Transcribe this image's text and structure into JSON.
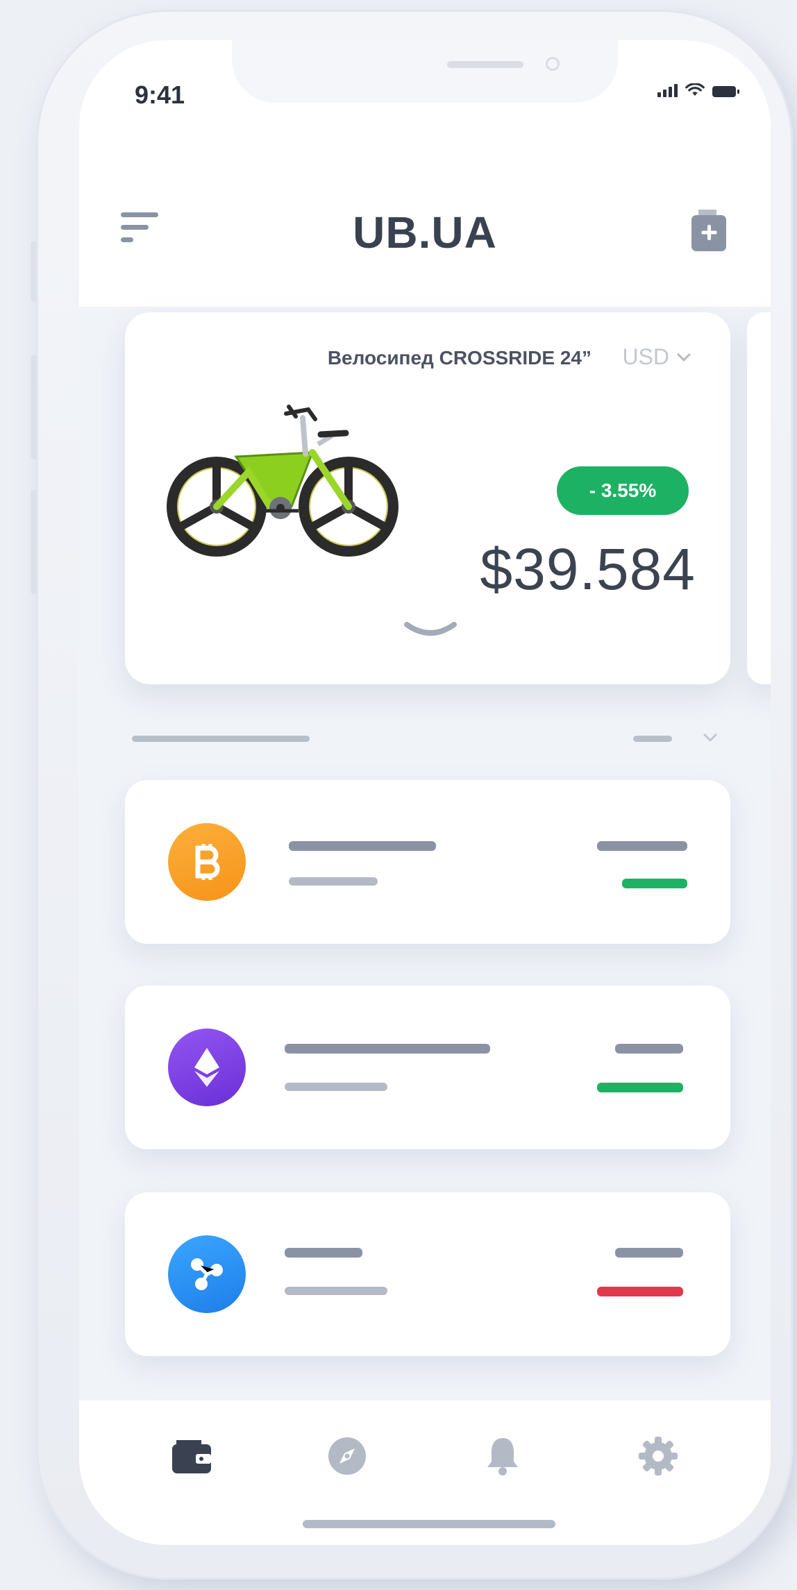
{
  "status_bar": {
    "time": "9:41"
  },
  "header": {
    "title": "UB.UA",
    "menu_icon": "filter-menu-icon",
    "action_icon": "add-file-icon"
  },
  "product_card": {
    "name": "Велосипед CROSSRIDE 24”",
    "currency": "USD",
    "change": "- 3.55%",
    "price": "$39.584",
    "image": "bicycle-illustration",
    "expand_icon": "chevron-down-icon"
  },
  "assets": [
    {
      "icon": "bitcoin-icon",
      "color": "#f7931a",
      "trend": "up",
      "trend_color": "#1db263"
    },
    {
      "icon": "ethereum-icon",
      "color": "#7b3fe4",
      "trend": "up",
      "trend_color": "#1db263"
    },
    {
      "icon": "ripple-icon",
      "color": "#1e8cf0",
      "trend": "down",
      "trend_color": "#e0394c"
    }
  ],
  "tab_bar": {
    "items": [
      {
        "icon": "wallet-icon",
        "active": true
      },
      {
        "icon": "compass-icon",
        "active": false
      },
      {
        "icon": "bell-icon",
        "active": false
      },
      {
        "icon": "gear-icon",
        "active": false
      }
    ]
  },
  "colors": {
    "accent_green": "#1db263",
    "accent_red": "#e0394c",
    "text_dark": "#3a4251",
    "placeholder_bar": "#8a93a3"
  }
}
